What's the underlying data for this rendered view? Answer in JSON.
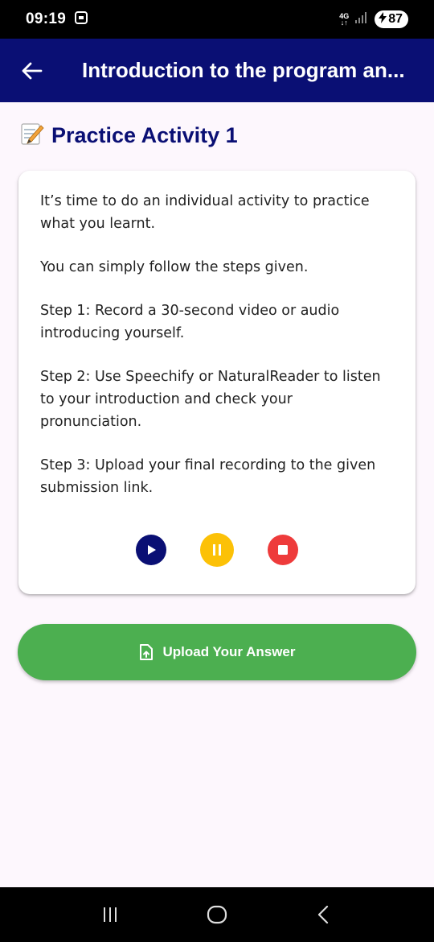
{
  "status_bar": {
    "time": "09:19",
    "network": "4G",
    "battery": "87"
  },
  "app_bar": {
    "title": "Introduction to the program an..."
  },
  "section": {
    "heading": "Practice Activity 1",
    "icon": "memo-icon"
  },
  "card": {
    "paragraphs": [
      "It’s time to do an individual activity to practice what you learnt.",
      "You can simply follow the steps given.",
      "Step 1: Record a 30-second video or audio introducing yourself.",
      "Step 2: Use Speechify or NaturalReader to listen to your introduction and check your pronunciation.",
      "Step 3: Upload your final recording to the given submission link."
    ],
    "controls": [
      "play-icon",
      "pause-icon",
      "stop-icon"
    ]
  },
  "upload": {
    "label": "Upload Your Answer",
    "icon": "file-upload-icon"
  },
  "colors": {
    "primary": "#0a0f74",
    "upload": "#4caf50",
    "pause": "#fcc107",
    "stop": "#ee3b3b",
    "background": "#fdf7fd"
  }
}
